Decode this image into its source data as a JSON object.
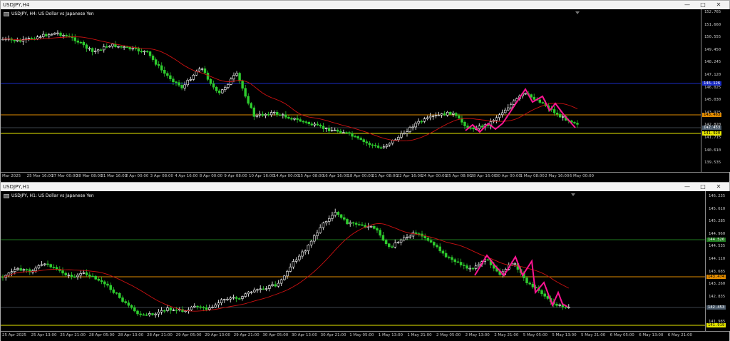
{
  "window1": {
    "title": "USDJPY,H4",
    "chart_label": "USDJPY, H4:  US Dollar vs Japanese Yen",
    "controls": [
      "—",
      "□",
      "✕"
    ],
    "y_labels": [
      "152.765",
      "151.660",
      "150.555",
      "149.450",
      "148.245",
      "147.120",
      "146.025",
      "145.030",
      "143.925",
      "142.820",
      "141.715",
      "140.610",
      "139.535"
    ],
    "y_tags": [
      {
        "label": "146.126",
        "bg": "#1a2cc8",
        "fg": "#ffffff"
      },
      {
        "label": "143.463",
        "bg": "#e08a00",
        "fg": "#000000"
      },
      {
        "label": "142.453",
        "bg": "#4a5a6a",
        "fg": "#ffffff"
      },
      {
        "label": "141.920",
        "bg": "#e8e800",
        "fg": "#000000"
      }
    ],
    "x_labels": [
      "Mar 2025",
      "25 Mar 16:00",
      "27 Mar 00:00",
      "28 Mar 08:00",
      "31 Mar 16:00",
      "2 Apr 00:00",
      "3 Apr 08:00",
      "4 Apr 16:00",
      "8 Apr 00:00",
      "9 Apr 08:00",
      "10 Apr 16:00",
      "14 Apr 00:00",
      "15 Apr 08:00",
      "16 Apr 16:00",
      "18 Apr 00:00",
      "21 Apr 08:00",
      "22 Apr 16:00",
      "24 Apr 00:00",
      "25 Apr 08:00",
      "28 Apr 16:00",
      "30 Apr 00:00",
      "1 May 08:00",
      "2 May 16:00",
      "6 May 00:00"
    ]
  },
  "window2": {
    "title": "USDJPY,H1",
    "chart_label": "USDJPY, H1:  US Dollar vs Japanese Yen",
    "controls": [
      "—",
      "□",
      "✕"
    ],
    "y_labels": [
      "146.235",
      "145.610",
      "145.285",
      "144.960",
      "144.535",
      "144.110",
      "143.685",
      "143.260",
      "142.835",
      "142.410",
      "141.985"
    ],
    "y_tags": [
      {
        "label": "144.526",
        "bg": "#1f7a1f",
        "fg": "#ffffff"
      },
      {
        "label": "143.474",
        "bg": "#e08a00",
        "fg": "#000000"
      },
      {
        "label": "142.453",
        "bg": "#4a5a6a",
        "fg": "#ffffff"
      },
      {
        "label": "141.919",
        "bg": "#e8e800",
        "fg": "#000000"
      }
    ],
    "x_labels": [
      "25 Apr 2025",
      "25 Apr 13:00",
      "25 Apr 21:00",
      "28 Apr 05:00",
      "28 Apr 13:00",
      "28 Apr 21:00",
      "29 Apr 05:00",
      "29 Apr 13:00",
      "29 Apr 21:00",
      "30 Apr 05:00",
      "30 Apr 13:00",
      "30 Apr 21:00",
      "1 May 05:00",
      "1 May 13:00",
      "1 May 21:00",
      "2 May 05:00",
      "2 May 13:00",
      "2 May 21:00",
      "5 May 05:00",
      "5 May 13:00",
      "5 May 21:00",
      "6 May 05:00",
      "6 May 13:00",
      "6 May 21:00"
    ]
  },
  "colors": {
    "bull": "#ffffff",
    "bear": "#2ecc2e",
    "ma": "#cc1111",
    "zigzag": "#ff1493",
    "blue_line": "#1a2cc8",
    "orange_line": "#e08a00",
    "yellow_line": "#e8e800",
    "gray_line": "#7a8a9a",
    "green_line": "#1f7a1f"
  }
}
